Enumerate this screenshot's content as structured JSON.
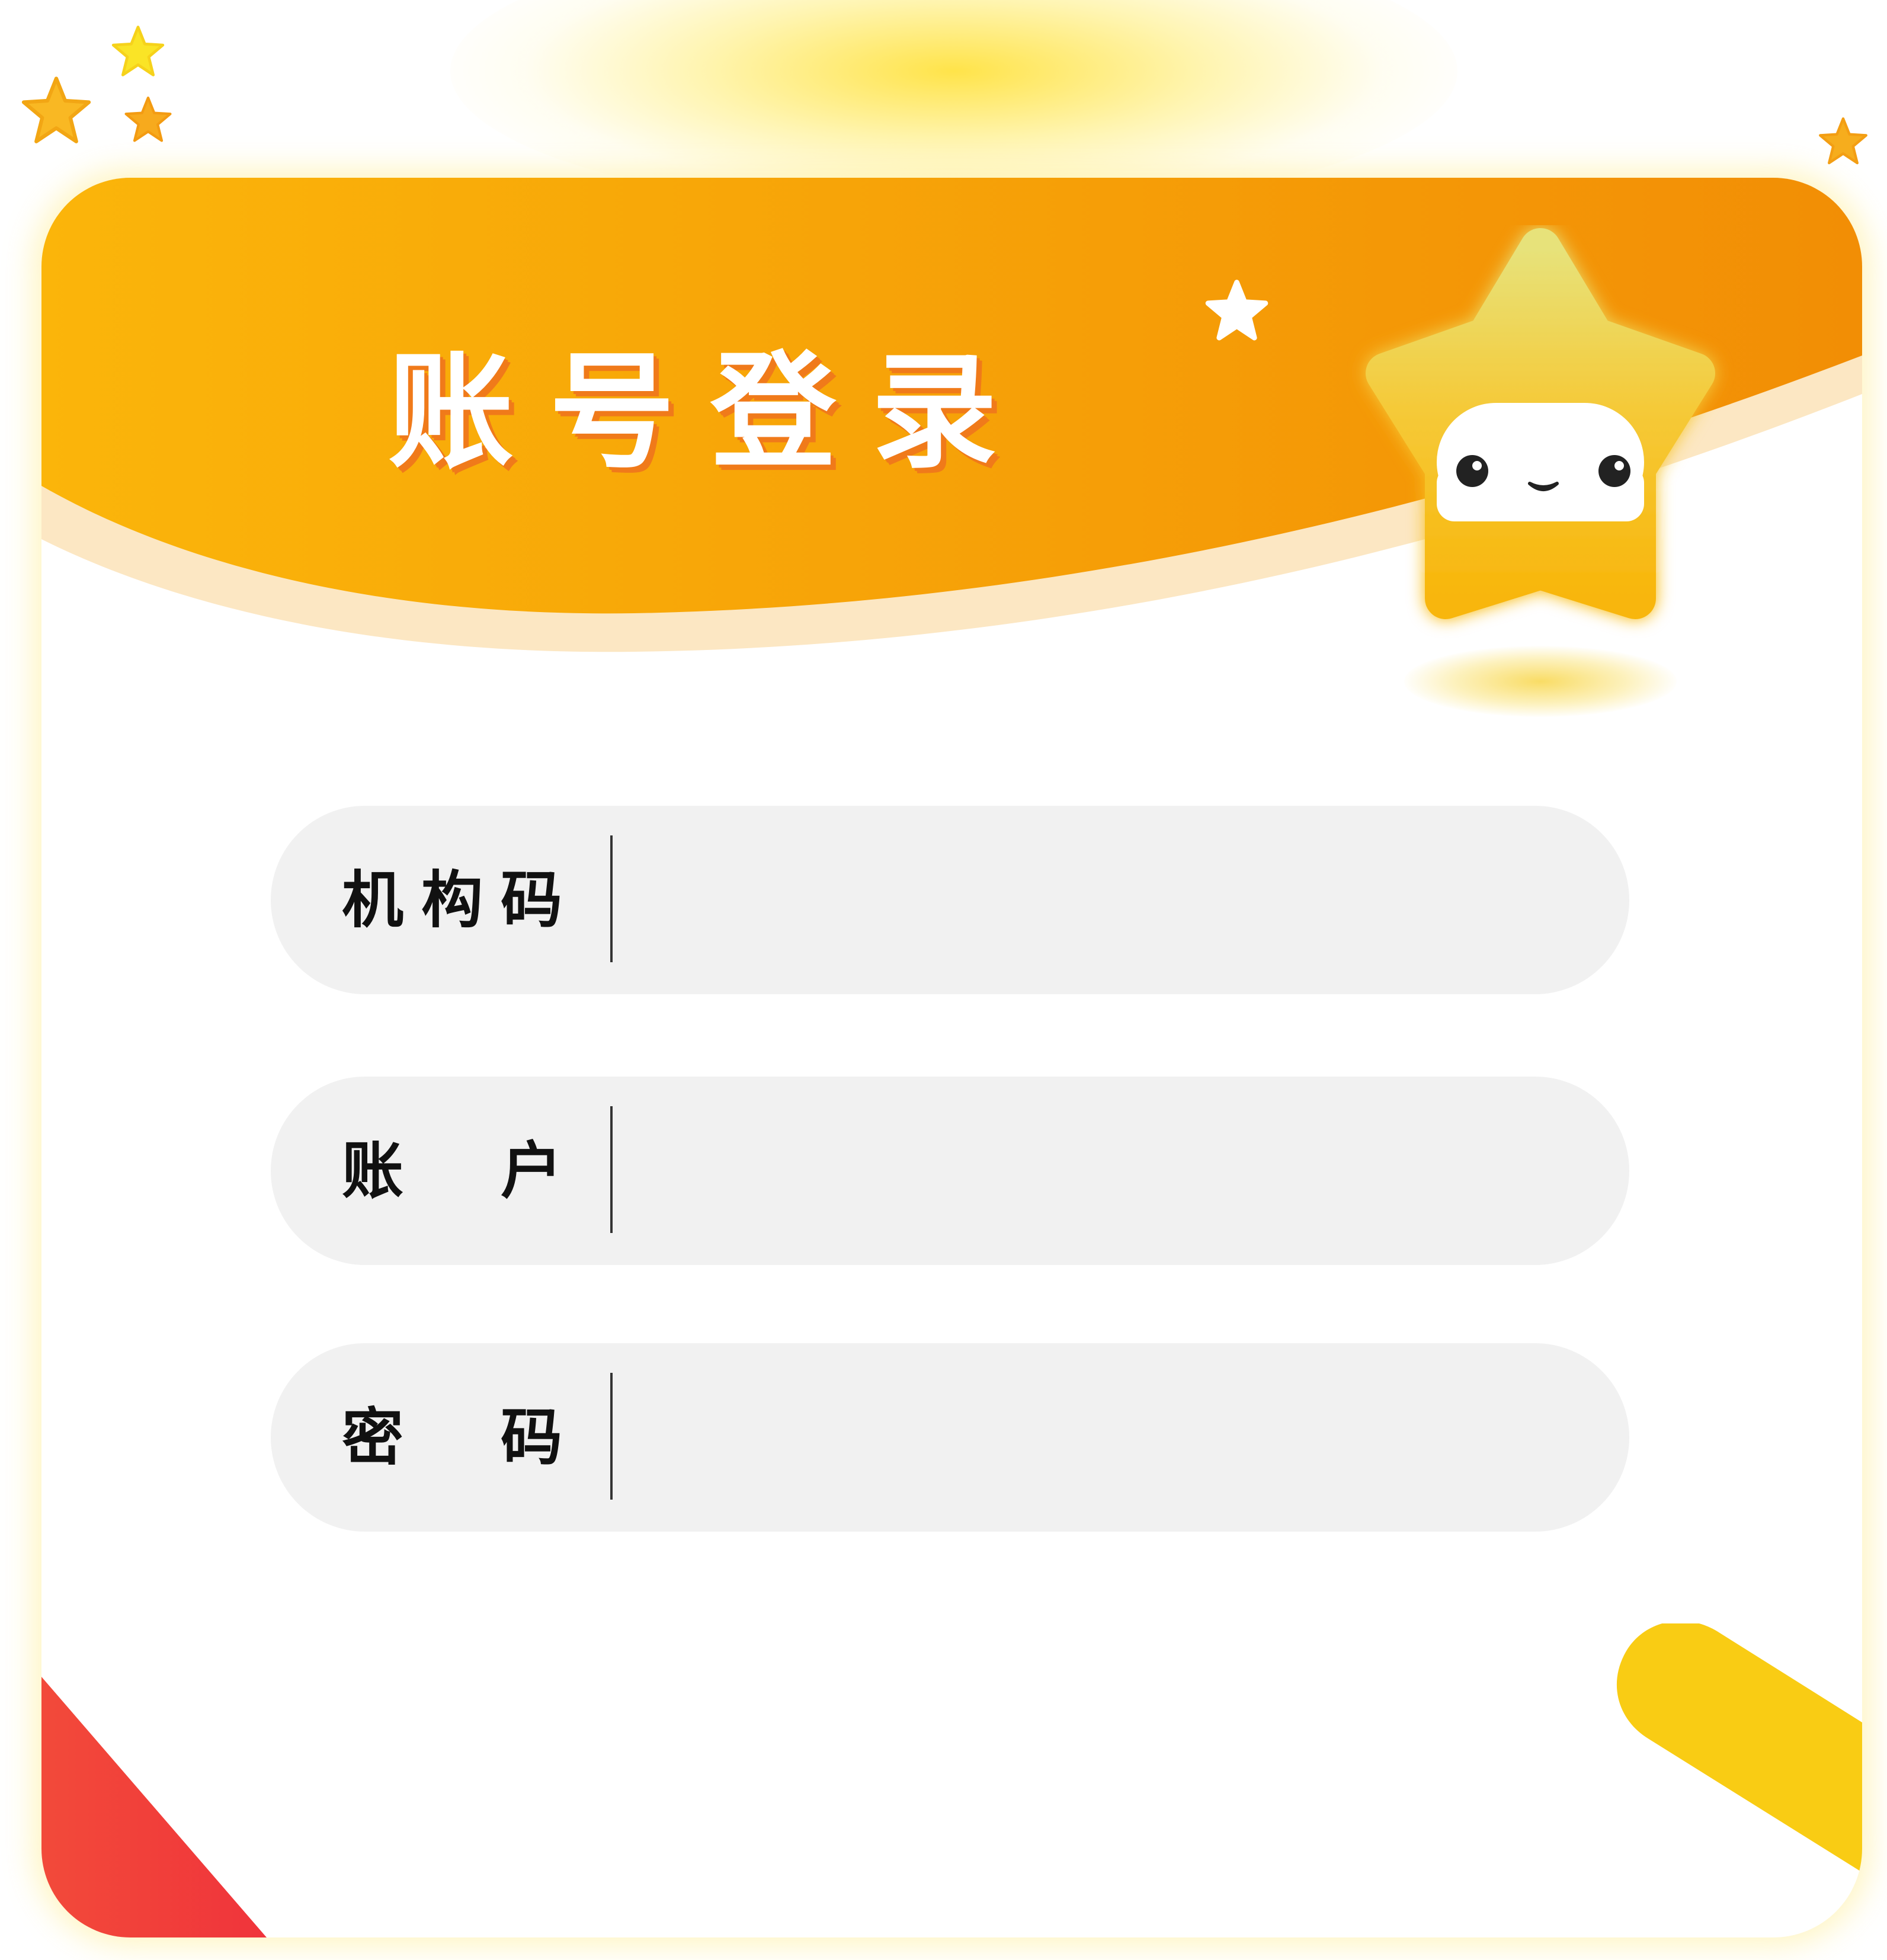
{
  "header": {
    "title": "账号登录"
  },
  "form": {
    "fields": [
      {
        "id": "org_code",
        "label": "机构码",
        "value": "",
        "type": "text"
      },
      {
        "id": "account",
        "label": "账　户",
        "value": "",
        "type": "text"
      },
      {
        "id": "password",
        "label": "密　码",
        "value": "",
        "type": "password"
      }
    ]
  },
  "decor": {
    "mascot": "star-mascot-icon",
    "sparkles": "star-icon",
    "colors": {
      "header_start": "#FBB50A",
      "header_end": "#F28E05",
      "wave_light": "#FCE7C3",
      "field_bg": "#F1F1F1",
      "accent_red": "#F0413A",
      "accent_yellow": "#F9CC14",
      "mascot_yellow": "#F7C21B"
    }
  }
}
